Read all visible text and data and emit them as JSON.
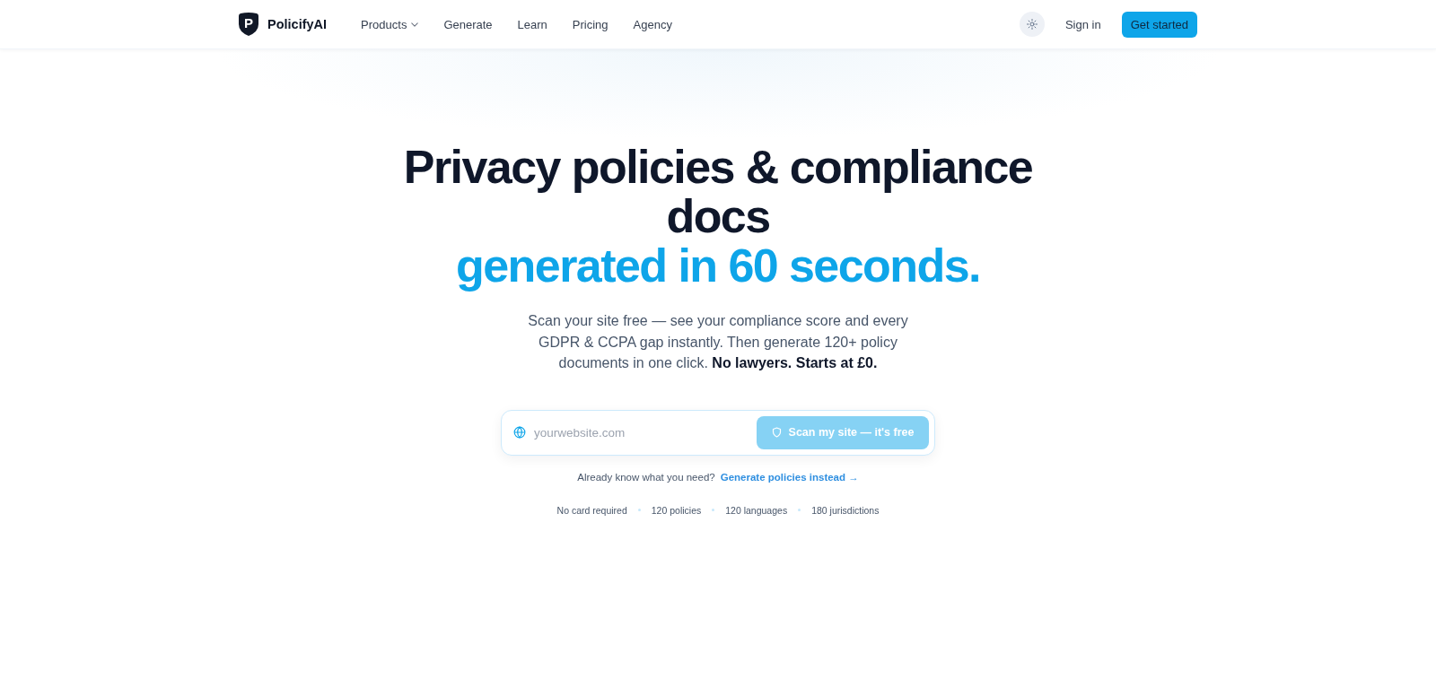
{
  "nav": {
    "brand": {
      "mark": "P",
      "name": "PolicifyAI"
    },
    "links": [
      {
        "label": "Products",
        "kind": "dropdown"
      },
      {
        "label": "Generate",
        "kind": "link"
      },
      {
        "label": "Learn",
        "kind": "link"
      },
      {
        "label": "Pricing",
        "kind": "link"
      },
      {
        "label": "Agency",
        "kind": "link"
      }
    ],
    "sign_in": "Sign in",
    "cta": "Get started"
  },
  "hero": {
    "title": "Privacy policies & compliance docs",
    "title_highlight": "generated in 60 seconds.",
    "subtitle": "Scan your site free — see your compliance score and every GDPR & CCPA gap instantly. Then generate 120+ policy documents in one click. **No lawyers. Starts at £0.**",
    "scan": {
      "placeholder": "yourwebsite.com",
      "button": "Scan my site — it's free",
      "disabled": true
    },
    "alt_prompt": "Already know what you need?",
    "alt_link": "Generate policies instead →",
    "features": [
      "No card required",
      "120 policies",
      "120 languages",
      "180 jurisdictions"
    ]
  }
}
